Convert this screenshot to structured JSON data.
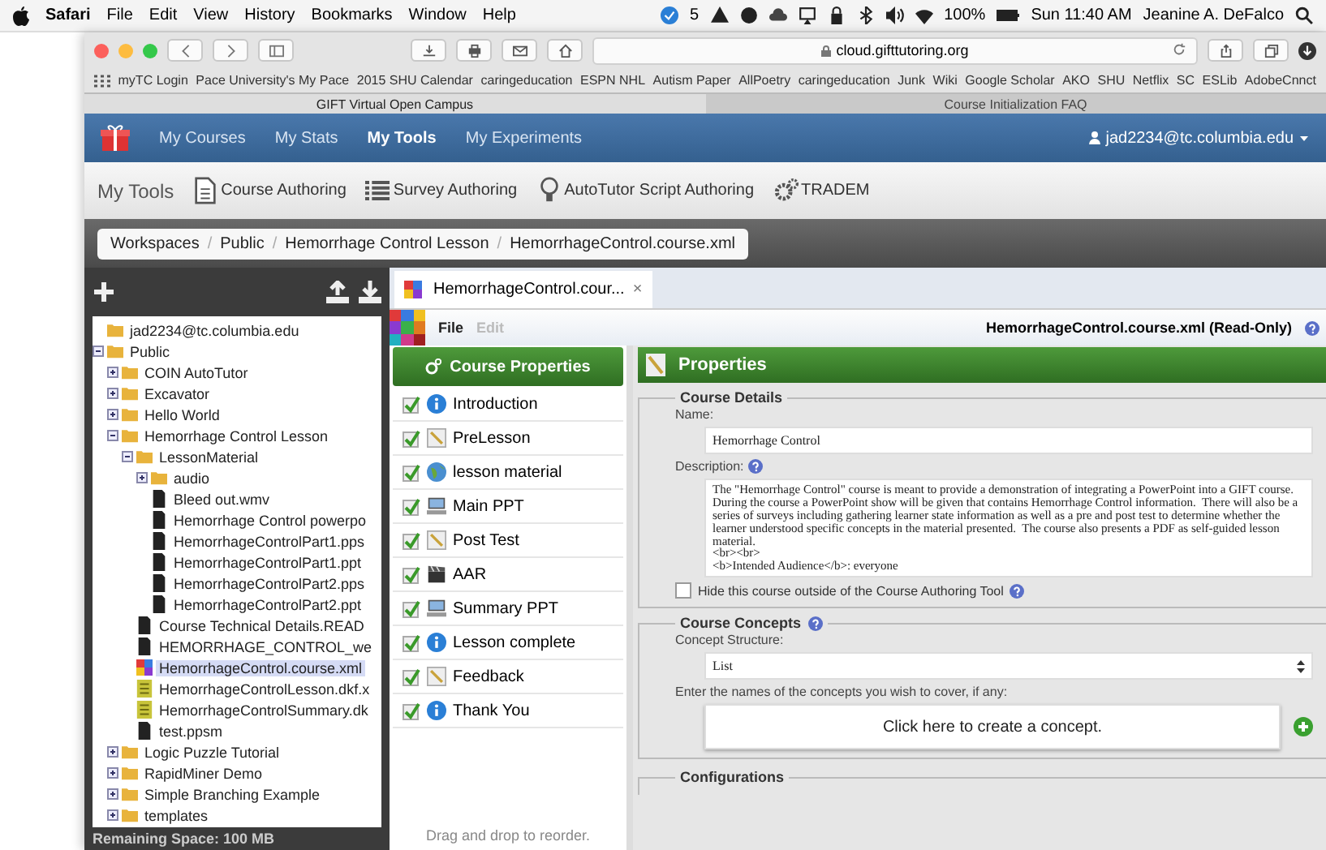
{
  "menu_bar": {
    "app": "Safari",
    "menus": [
      "File",
      "Edit",
      "View",
      "History",
      "Bookmarks",
      "Window",
      "Help"
    ],
    "badge_count": "5",
    "battery": "100%",
    "clock": "Sun 11:40 AM",
    "user": "Jeanine A. DeFalco"
  },
  "browser": {
    "address": "cloud.gifttutoring.org",
    "bookmarks": [
      "myTC Login",
      "Pace University's My Pace",
      "2015 SHU Calendar",
      "caringeducation",
      "ESPN NHL",
      "Autism Paper",
      "AllPoetry",
      "caringeducation",
      "Junk",
      "Wiki",
      "Google Scholar",
      "AKO",
      "SHU",
      "Netflix",
      "SC",
      "ESLib",
      "AdobeCnnct"
    ],
    "tabs": [
      {
        "title": "GIFT Virtual Open Campus",
        "selected": true
      },
      {
        "title": "Course Initialization FAQ",
        "selected": false
      }
    ]
  },
  "nav": {
    "items": [
      {
        "label": "My Courses",
        "selected": false
      },
      {
        "label": "My Stats",
        "selected": false
      },
      {
        "label": "My Tools",
        "selected": true
      },
      {
        "label": "My Experiments",
        "selected": false
      }
    ],
    "account": "jad2234@tc.columbia.edu"
  },
  "tools": {
    "title": "My Tools",
    "items": [
      {
        "label": "Course Authoring",
        "kind": "document"
      },
      {
        "label": "Survey Authoring",
        "kind": "list"
      },
      {
        "label": "AutoTutor Script Authoring",
        "kind": "bulb"
      },
      {
        "label": "TRADEM",
        "kind": "gears"
      }
    ]
  },
  "breadcrumb_separator": "/",
  "breadcrumb": [
    "Workspaces",
    "Public",
    "Hemorrhage Control Lesson",
    "HemorrhageControl.course.xml"
  ],
  "file_tree": {
    "nodes": [
      {
        "label": "jad2234@tc.columbia.edu",
        "kind": "folder",
        "selected": false
      },
      {
        "label": "Public",
        "kind": "folder",
        "expanded": true,
        "selected": false,
        "children": [
          {
            "label": "COIN AutoTutor",
            "kind": "folder",
            "expanded": false,
            "selected": false
          },
          {
            "label": "Excavator",
            "kind": "folder",
            "expanded": false,
            "selected": false
          },
          {
            "label": "Hello World",
            "kind": "folder",
            "expanded": false,
            "selected": false
          },
          {
            "label": "Hemorrhage Control Lesson",
            "kind": "folder",
            "expanded": true,
            "selected": false,
            "children": [
              {
                "label": "LessonMaterial",
                "kind": "folder",
                "expanded": true,
                "selected": false,
                "children": [
                  {
                    "label": "audio",
                    "kind": "folder",
                    "expanded": false,
                    "selected": false
                  },
                  {
                    "label": "Bleed out.wmv",
                    "kind": "file",
                    "selected": false
                  },
                  {
                    "label": "Hemorrhage Control powerpo",
                    "kind": "file",
                    "selected": false
                  },
                  {
                    "label": "HemorrhageControlPart1.pps",
                    "kind": "file",
                    "selected": false
                  },
                  {
                    "label": "HemorrhageControlPart1.ppt",
                    "kind": "file",
                    "selected": false
                  },
                  {
                    "label": "HemorrhageControlPart2.pps",
                    "kind": "file",
                    "selected": false
                  },
                  {
                    "label": "HemorrhageControlPart2.ppt",
                    "kind": "file",
                    "selected": false
                  }
                ]
              },
              {
                "label": "Course Technical Details.READ",
                "kind": "file",
                "selected": false
              },
              {
                "label": "HEMORRHAGE_CONTROL_we",
                "kind": "file",
                "selected": false
              },
              {
                "label": "HemorrhageControl.course.xml",
                "kind": "course",
                "selected": true
              },
              {
                "label": "HemorrhageControlLesson.dkf.x",
                "kind": "dkf",
                "selected": false
              },
              {
                "label": "HemorrhageControlSummary.dk",
                "kind": "dkf",
                "selected": false
              },
              {
                "label": "test.ppsm",
                "kind": "file",
                "selected": false
              }
            ]
          },
          {
            "label": "Logic Puzzle Tutorial",
            "kind": "folder",
            "expanded": false,
            "selected": false
          },
          {
            "label": "RapidMiner Demo",
            "kind": "folder",
            "expanded": false,
            "selected": false
          },
          {
            "label": "Simple Branching Example",
            "kind": "folder",
            "expanded": false,
            "selected": false
          },
          {
            "label": "templates",
            "kind": "folder",
            "expanded": false,
            "selected": false
          }
        ]
      }
    ],
    "remaining_space": "Remaining Space: 100 MB"
  },
  "editor": {
    "tab": "HemorrhageControl.cour...",
    "tab_close": "×",
    "menus": [
      {
        "label": "File",
        "disabled": false
      },
      {
        "label": "Edit",
        "disabled": true
      }
    ],
    "file_title": "HemorrhageControl.course.xml (Read-Only)",
    "course_properties": "Course Properties",
    "objects": [
      {
        "label": "Introduction",
        "kind": "info",
        "checked": true
      },
      {
        "label": "PreLesson",
        "kind": "ruler",
        "checked": true
      },
      {
        "label": "lesson material",
        "kind": "globe",
        "checked": true
      },
      {
        "label": "Main PPT",
        "kind": "computer",
        "checked": true
      },
      {
        "label": "Post Test",
        "kind": "ruler",
        "checked": true
      },
      {
        "label": "AAR",
        "kind": "clapper",
        "checked": true
      },
      {
        "label": "Summary PPT",
        "kind": "computer",
        "checked": true
      },
      {
        "label": "Lesson complete",
        "kind": "info",
        "checked": true
      },
      {
        "label": "Feedback",
        "kind": "ruler",
        "checked": true
      },
      {
        "label": "Thank You",
        "kind": "info",
        "checked": true
      }
    ],
    "drag_hint": "Drag and drop to reorder."
  },
  "properties": {
    "title": "Properties",
    "details": {
      "legend": "Course Details",
      "name_label": "Name:",
      "name": "Hemorrhage Control",
      "description_label": "Description:",
      "description": "The \"Hemorrhage Control\" course is meant to provide a demonstration of integrating a PowerPoint into a GIFT course.  During the course a PowerPoint show will be given that contains Hemorrhage Control information.  There will also be a series of surveys including gathering learner state information as well as a pre and post test to determine whether the learner understood specific concepts in the material presented.  The course also presents a PDF as self-guided lesson material.\n<br><br>\n<b>Intended Audience</b>: everyone",
      "hide_label": "Hide this course outside of the Course Authoring Tool",
      "hide_checked": false
    },
    "concepts": {
      "legend": "Course Concepts",
      "structure_label": "Concept Structure:",
      "structure": "List",
      "names_label": "Enter the names of the concepts you wish to cover, if any:",
      "create_button": "Click here to create a concept."
    },
    "configurations": {
      "legend": "Configurations"
    }
  }
}
